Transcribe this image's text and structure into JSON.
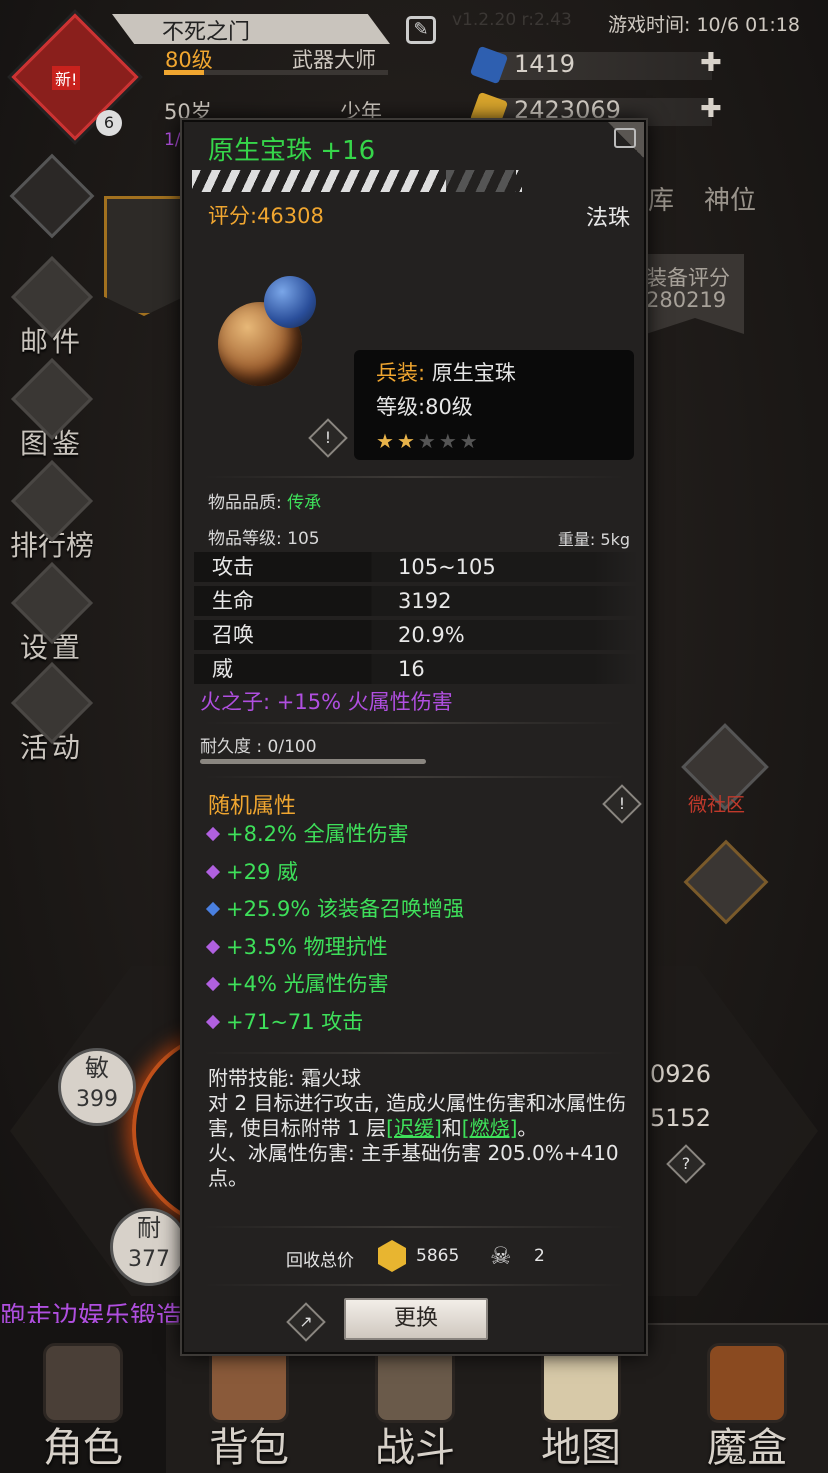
{
  "top": {
    "name": "不死之门",
    "level": "80级",
    "title": "武器大师",
    "age": "50岁",
    "stage": "少年",
    "partial_small": "1/",
    "new_badge": "新!",
    "rank_num": "6",
    "version_partial": "v1.2.20 r:2.43",
    "game_time": "游戏时间: 10/6 01:18",
    "gems": "1419",
    "gold": "2423069",
    "plus": "✚",
    "tabs": [
      "库",
      "神位"
    ],
    "equip_score_label": "装备评分",
    "equip_score": "280219"
  },
  "sidebar": [
    {
      "label": "邮件",
      "icon": "mail-icon"
    },
    {
      "label": "图鉴",
      "icon": "book-icon"
    },
    {
      "label": "排行榜",
      "icon": "ranking-icon"
    },
    {
      "label": "设置",
      "icon": "gear-icon"
    },
    {
      "label": "活动",
      "icon": "activity-icon"
    }
  ],
  "right_icons": {
    "community": "微社区"
  },
  "attrs": {
    "agi_label": "敏",
    "agi": "399",
    "dur_label": "耐",
    "dur": "377",
    "right1": "0926",
    "right2": "5152"
  },
  "ticker": "跑走边娱乐锻造",
  "tooltip": {
    "title": "原生宝珠 +16",
    "score": "评分:46308",
    "type": "法珠",
    "info": {
      "kind_label": "兵装:",
      "kind": "原生宝珠",
      "level_label": "等级:",
      "level": "80级",
      "stars_filled": 2,
      "stars_total": 5
    },
    "quality_label": "物品品质:",
    "quality": "传承",
    "item_level": "物品等级: 105",
    "weight": "重量: 5kg",
    "stats": [
      {
        "name": "攻击",
        "value": "105~105"
      },
      {
        "name": "生命",
        "value": "3192"
      },
      {
        "name": "召唤",
        "value": "20.9%"
      },
      {
        "name": "威",
        "value": "16"
      }
    ],
    "set_bonus": "火之子: +15% 火属性伤害",
    "durability": "耐久度 : 0/100",
    "random_title": "随机属性",
    "random": [
      {
        "text": "+8.2% 全属性伤害",
        "gem": "#b060e0"
      },
      {
        "text": "+29 威",
        "gem": "#b060e0"
      },
      {
        "text": "+25.9% 该装备召唤增强",
        "gem": "#4a80e0"
      },
      {
        "text": "+3.5% 物理抗性",
        "gem": "#b060e0"
      },
      {
        "text": "+4% 光属性伤害",
        "gem": "#b060e0"
      },
      {
        "text": "+71~71 攻击",
        "gem": "#b060e0"
      }
    ],
    "skill_title": "附带技能: 霜火球",
    "skill_desc1": "对 2 目标进行攻击, 造成火属性伤害和冰属性伤害, 使目标附带 1 层",
    "skill_link1": "[迟缓]",
    "skill_and": "和",
    "skill_link2": "[燃烧]",
    "skill_end": "。",
    "skill_desc2": "火、冰属性伤害: 主手基础伤害 205.0%+410 点。",
    "recycle_label": "回收总价",
    "recycle_gold": "5865",
    "recycle_skull": "2",
    "replace": "更换",
    "warn": "!"
  },
  "bottom_tabs": [
    {
      "label": "角色"
    },
    {
      "label": "背包"
    },
    {
      "label": "战斗"
    },
    {
      "label": "地图"
    },
    {
      "label": "魔盒"
    }
  ]
}
